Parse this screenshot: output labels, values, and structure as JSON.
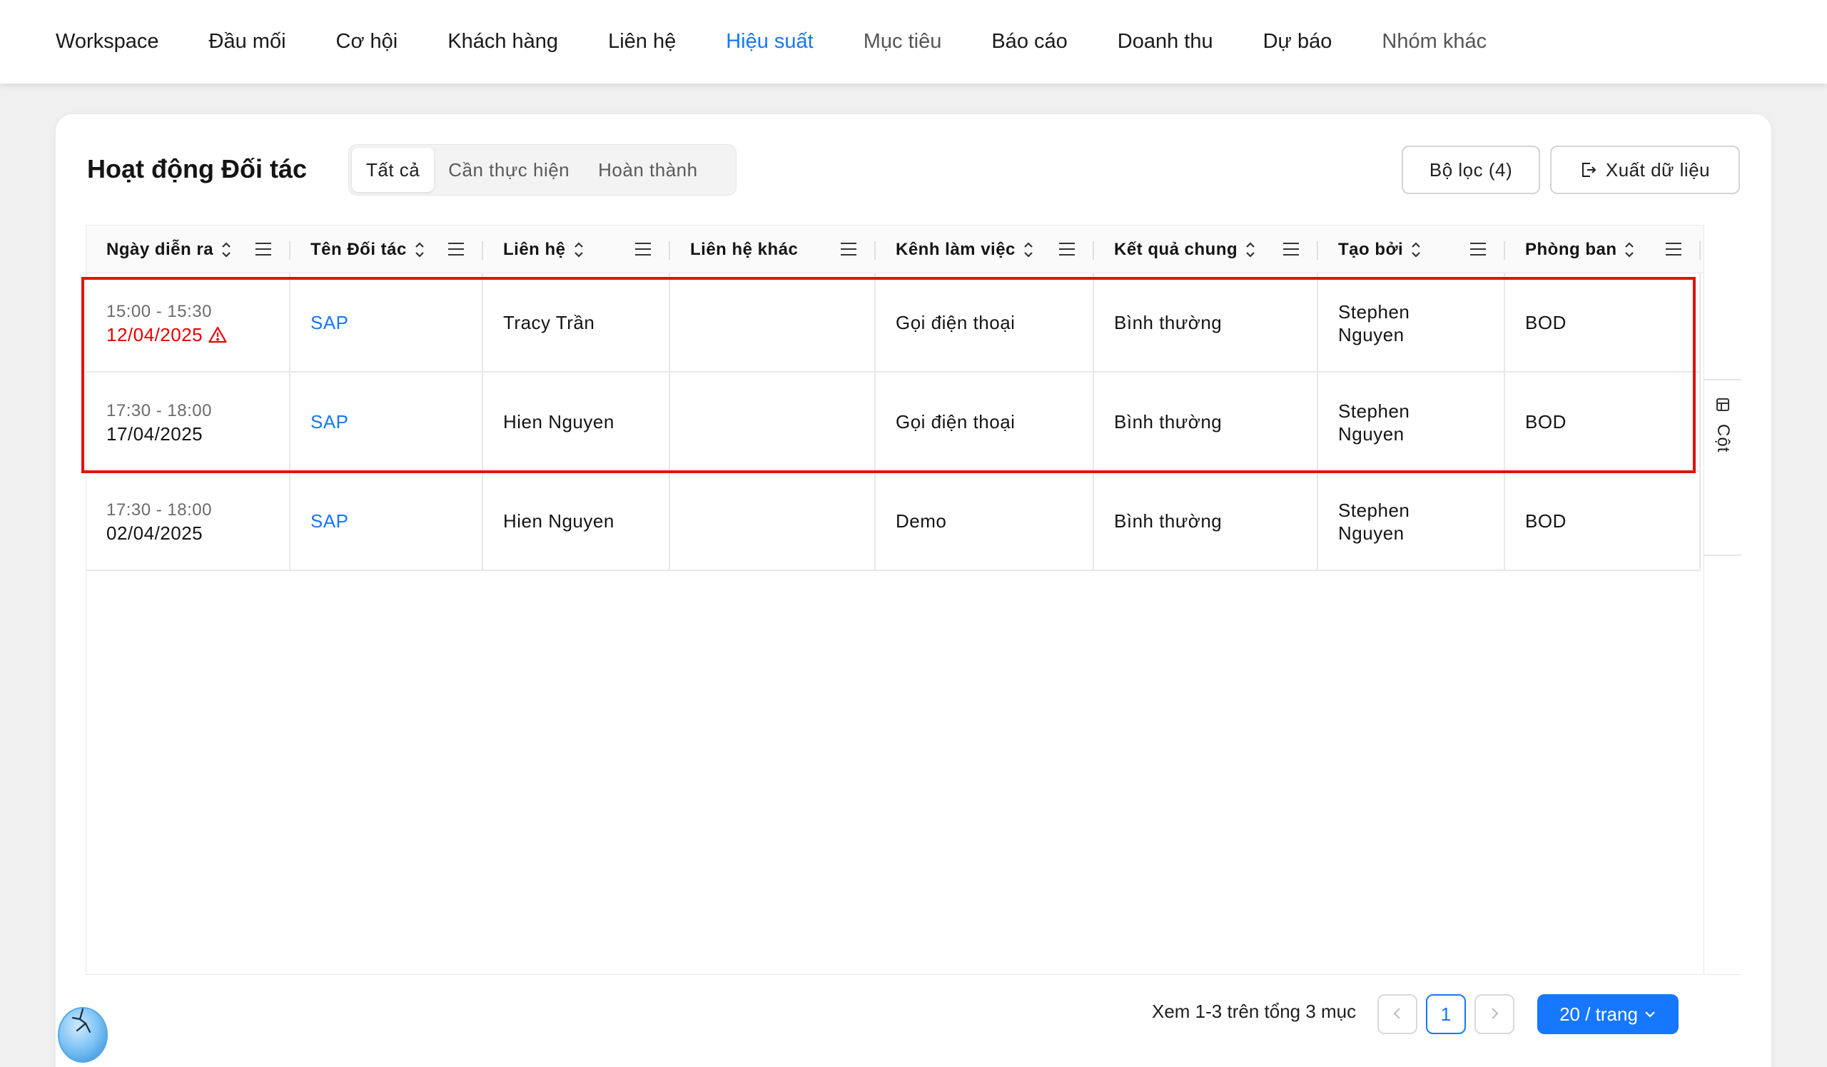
{
  "nav": {
    "items": [
      {
        "label": "Workspace"
      },
      {
        "label": "Đầu mối"
      },
      {
        "label": "Cơ hội"
      },
      {
        "label": "Khách hàng"
      },
      {
        "label": "Liên hệ"
      },
      {
        "label": "Hiệu suất"
      },
      {
        "label": "Mục tiêu"
      },
      {
        "label": "Báo cáo"
      },
      {
        "label": "Doanh thu"
      },
      {
        "label": "Dự báo"
      },
      {
        "label": "Nhóm khác"
      }
    ],
    "active_index": 5
  },
  "card": {
    "title": "Hoạt động Đối tác",
    "tabs": [
      {
        "label": "Tất cả"
      },
      {
        "label": "Cần thực hiện"
      },
      {
        "label": "Hoàn thành"
      }
    ],
    "filter_label": "Bộ lọc (4)",
    "export_label": "Xuất dữ liệu"
  },
  "table": {
    "columns": [
      {
        "label": "Ngày diễn ra"
      },
      {
        "label": "Tên Đối tác"
      },
      {
        "label": "Liên hệ"
      },
      {
        "label": "Liên hệ khác"
      },
      {
        "label": "Kênh làm việc"
      },
      {
        "label": "Kết quả chung"
      },
      {
        "label": "Tạo bởi"
      },
      {
        "label": "Phòng ban"
      }
    ],
    "rows": [
      {
        "time": "15:00 - 15:30",
        "date": "12/04/2025",
        "overdue": true,
        "partner": "SAP",
        "contact": "Tracy Trần",
        "other_contact": "",
        "channel": "Gọi điện thoại",
        "result": "Bình thường",
        "created_by_1": "Stephen",
        "created_by_2": "Nguyen",
        "department": "BOD"
      },
      {
        "time": "17:30 - 18:00",
        "date": "17/04/2025",
        "overdue": false,
        "partner": "SAP",
        "contact": "Hien Nguyen",
        "other_contact": "",
        "channel": "Gọi điện thoại",
        "result": "Bình thường",
        "created_by_1": "Stephen",
        "created_by_2": "Nguyen",
        "department": "BOD"
      },
      {
        "time": "17:30 - 18:00",
        "date": "02/04/2025",
        "overdue": false,
        "partner": "SAP",
        "contact": "Hien Nguyen",
        "other_contact": "",
        "channel": "Demo",
        "result": "Bình thường",
        "created_by_1": "Stephen",
        "created_by_2": "Nguyen",
        "department": "BOD"
      }
    ],
    "column_tab_label": "Cột"
  },
  "pagination": {
    "summary": "Xem 1-3 trên tổng 3 mục",
    "current_page": "1",
    "page_size": "20 / trang"
  },
  "colors": {
    "accent": "#1677ff",
    "overdue": "#e60000",
    "highlight": "#e3120b"
  }
}
